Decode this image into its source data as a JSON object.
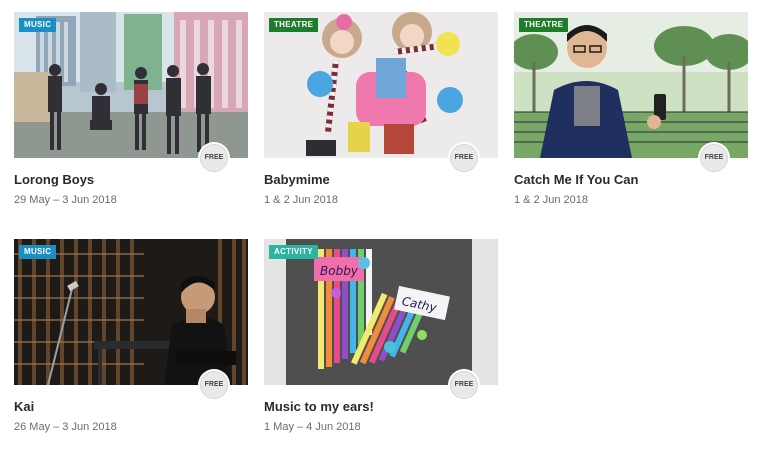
{
  "colors": {
    "music_tag": "#1a8fc4",
    "theatre_tag": "#1e7d2b",
    "activity_tag": "#2bb5a0",
    "free_badge_bg": "#e9e9e9"
  },
  "events": [
    {
      "category": "MUSIC",
      "title": "Lorong Boys",
      "date": "29 May – 3 Jun 2018",
      "badge": "FREE"
    },
    {
      "category": "THEATRE",
      "title": "Babymime",
      "date": "1 & 2 Jun 2018",
      "badge": "FREE"
    },
    {
      "category": "THEATRE",
      "title": "Catch Me If You Can",
      "date": "1 & 2 Jun 2018",
      "badge": "FREE"
    },
    {
      "category": "MUSIC",
      "title": "Kai",
      "date": "26 May – 3 Jun 2018",
      "badge": "FREE"
    },
    {
      "category": "ACTIVITY",
      "title": "Music to my ears!",
      "date": "1 May – 4 Jun 2018",
      "badge": "FREE"
    }
  ],
  "image_text": {
    "name_tag_1": "Bobby",
    "name_tag_2": "Cathy"
  }
}
